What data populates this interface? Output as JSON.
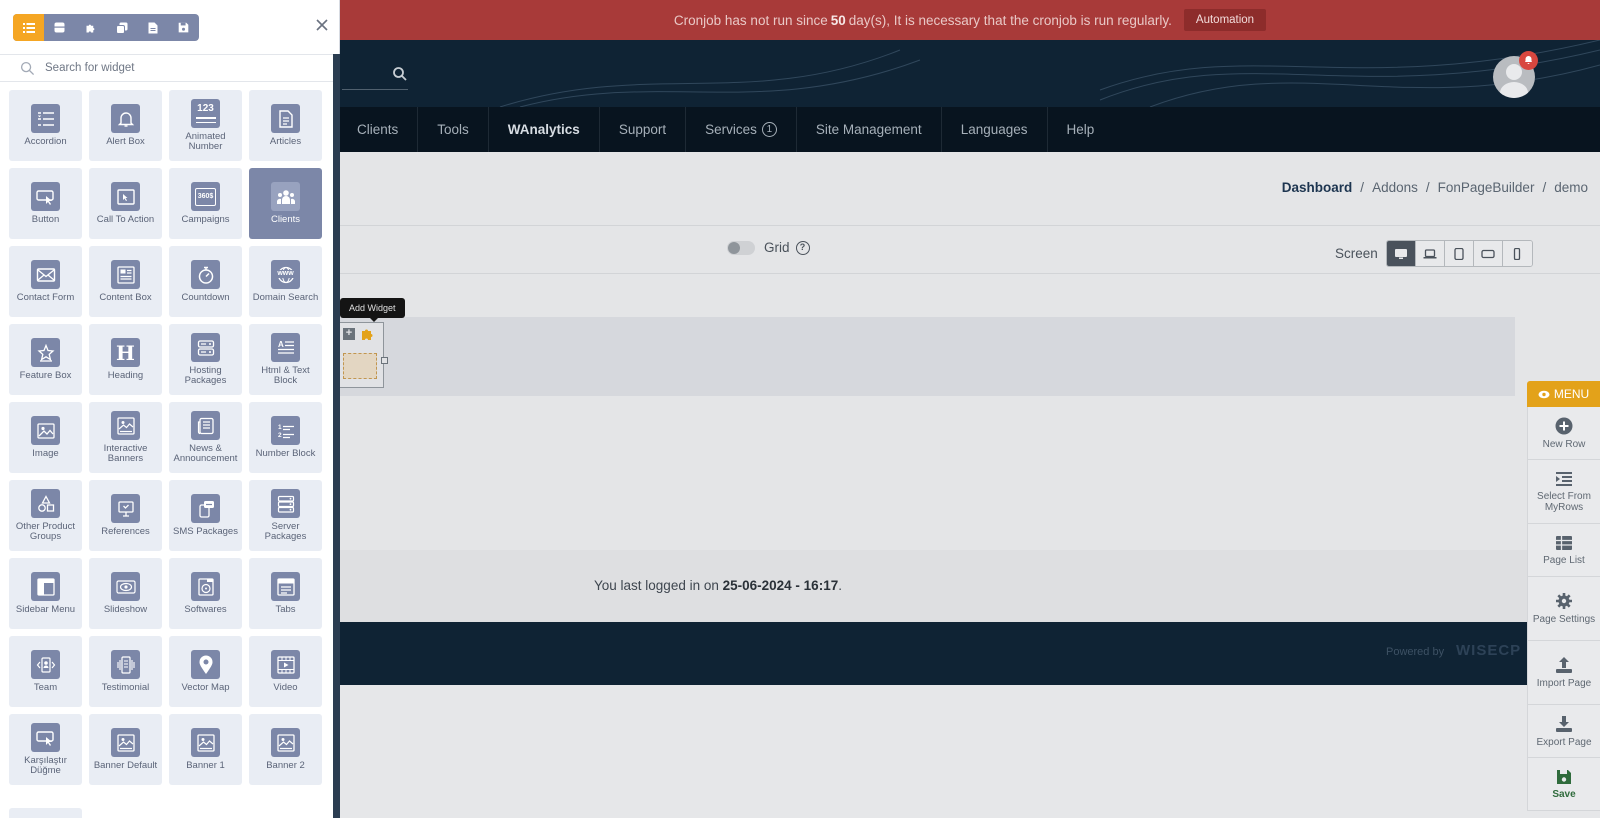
{
  "alert": {
    "text_before": "Cronjob has not run since",
    "days": "50",
    "text_after": "day(s), It is necessary that the cronjob is run regularly.",
    "button": "Automation"
  },
  "nav": {
    "items": [
      "Clients",
      "Tools",
      "WAnalytics",
      "Support",
      "Services",
      "Site Management",
      "Languages",
      "Help"
    ],
    "services_badge": "1",
    "notification_count": "!"
  },
  "breadcrumb": {
    "dashboard": "Dashboard",
    "sep": "/",
    "addons": "Addons",
    "builder": "FonPageBuilder",
    "page": "demo"
  },
  "toolbar": {
    "grid_label": "Grid",
    "help_glyph": "?",
    "screen_label": "Screen"
  },
  "builder": {
    "tooltip": "Add Widget",
    "add_glyph": "+"
  },
  "footer": {
    "last_login_prefix": "You last logged in on",
    "last_login_value": "25-06-2024 - 16:17",
    "last_login_suffix": ".",
    "powered_by": "Powered by",
    "brand": "WISECP"
  },
  "right_menu": {
    "title": "MENU",
    "items": [
      {
        "label": "New Row",
        "icon": "plus-circle-icon"
      },
      {
        "label": "Select From MyRows",
        "icon": "indent-icon"
      },
      {
        "label": "Page List",
        "icon": "table-icon"
      },
      {
        "label": "Page Settings",
        "icon": "gear-icon"
      },
      {
        "label": "Import Page",
        "icon": "upload-icon"
      },
      {
        "label": "Export Page",
        "icon": "download-icon"
      },
      {
        "label": "Save",
        "icon": "floppy-icon"
      }
    ]
  },
  "panel": {
    "search_placeholder": "Search for widget",
    "tabs": [
      "list-icon",
      "box-icon",
      "puzzle-icon",
      "copy-icon",
      "file-icon",
      "floppy-icon"
    ],
    "active_widget": "Clients",
    "widgets": [
      {
        "label": "Accordion",
        "icon": "accordion-icon"
      },
      {
        "label": "Alert Box",
        "icon": "bell-icon"
      },
      {
        "label": "Animated Number",
        "icon": "numbers-icon",
        "icon_text": "123"
      },
      {
        "label": "Articles",
        "icon": "document-icon"
      },
      {
        "label": "Button",
        "icon": "cursor-icon"
      },
      {
        "label": "Call To Action",
        "icon": "cta-icon"
      },
      {
        "label": "Campaigns",
        "icon": "campaign-icon",
        "icon_text": "360$"
      },
      {
        "label": "Clients",
        "icon": "users-icon"
      },
      {
        "label": "Contact Form",
        "icon": "envelope-icon"
      },
      {
        "label": "Content Box",
        "icon": "content-box-icon"
      },
      {
        "label": "Countdown",
        "icon": "stopwatch-icon"
      },
      {
        "label": "Domain Search",
        "icon": "globe-icon",
        "icon_text": "www"
      },
      {
        "label": "Feature Box",
        "icon": "star-icon"
      },
      {
        "label": "Heading",
        "icon": "heading-icon",
        "icon_text": "H"
      },
      {
        "label": "Hosting Packages",
        "icon": "server-icon"
      },
      {
        "label": "Html & Text Block",
        "icon": "text-block-icon"
      },
      {
        "label": "Image",
        "icon": "image-icon"
      },
      {
        "label": "Interactive Banners",
        "icon": "banner-icon"
      },
      {
        "label": "News & Announcement",
        "icon": "news-icon"
      },
      {
        "label": "Number Block",
        "icon": "number-list-icon"
      },
      {
        "label": "Other Product Groups",
        "icon": "shapes-icon"
      },
      {
        "label": "References",
        "icon": "presentation-icon"
      },
      {
        "label": "SMS Packages",
        "icon": "sms-icon"
      },
      {
        "label": "Server Packages",
        "icon": "server-stack-icon"
      },
      {
        "label": "Sidebar Menu",
        "icon": "sidebar-icon"
      },
      {
        "label": "Slideshow",
        "icon": "eye-icon"
      },
      {
        "label": "Softwares",
        "icon": "disc-icon"
      },
      {
        "label": "Tabs",
        "icon": "tabs-icon"
      },
      {
        "label": "Team",
        "icon": "team-icon"
      },
      {
        "label": "Testimonial",
        "icon": "testimonial-icon"
      },
      {
        "label": "Vector Map",
        "icon": "map-pin-icon"
      },
      {
        "label": "Video",
        "icon": "video-icon"
      },
      {
        "label": "Karşılaştır Düğme",
        "icon": "cursor-icon"
      },
      {
        "label": "Banner Default",
        "icon": "banner-icon"
      },
      {
        "label": "Banner 1",
        "icon": "banner-icon"
      },
      {
        "label": "Banner 2",
        "icon": "banner-icon"
      }
    ]
  }
}
